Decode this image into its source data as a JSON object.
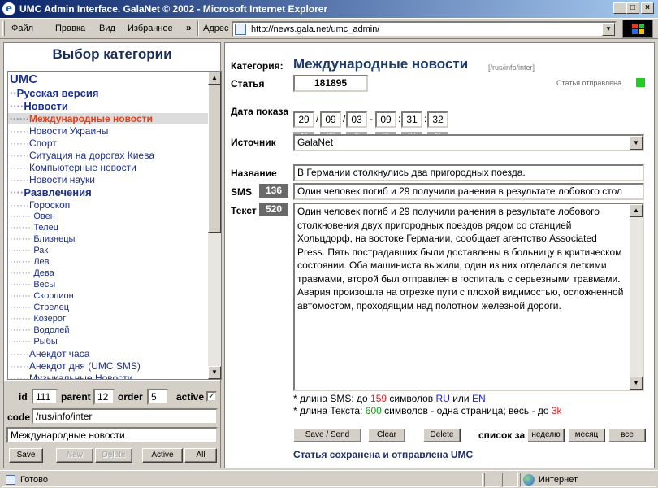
{
  "window": {
    "title": "UMC Admin Interface.   GalaNet © 2002 - Microsoft Internet Explorer",
    "icon": "ie-icon"
  },
  "menu": {
    "items": [
      "Файл",
      "Правка",
      "Вид",
      "Избранное"
    ],
    "more": "»",
    "address_label": "Адрес",
    "url": "http://news.gala.net/umc_admin/"
  },
  "left": {
    "title": "Выбор категории",
    "tree": [
      {
        "dots": "",
        "label": "UMC",
        "style": "root"
      },
      {
        "dots": "··",
        "label": "Русская версия",
        "style": "bold"
      },
      {
        "dots": "····",
        "label": "Новости",
        "style": "bold"
      },
      {
        "dots": "······",
        "label": "Международные новости",
        "style": "sel"
      },
      {
        "dots": "······",
        "label": "Новости Украины",
        "style": ""
      },
      {
        "dots": "······",
        "label": "Спорт",
        "style": ""
      },
      {
        "dots": "······",
        "label": "Ситуация на дорогах Киева",
        "style": ""
      },
      {
        "dots": "······",
        "label": "Компьютерные новости",
        "style": ""
      },
      {
        "dots": "······",
        "label": "Новости науки",
        "style": ""
      },
      {
        "dots": "····",
        "label": "Развлечения",
        "style": "bold"
      },
      {
        "dots": "······",
        "label": "Гороскоп",
        "style": ""
      },
      {
        "dots": "········",
        "label": "Овен",
        "style": "small"
      },
      {
        "dots": "········",
        "label": "Телец",
        "style": "small"
      },
      {
        "dots": "········",
        "label": "Близнецы",
        "style": "small"
      },
      {
        "dots": "········",
        "label": "Рак",
        "style": "small"
      },
      {
        "dots": "········",
        "label": "Лев",
        "style": "small"
      },
      {
        "dots": "········",
        "label": "Дева",
        "style": "small"
      },
      {
        "dots": "········",
        "label": "Весы",
        "style": "small"
      },
      {
        "dots": "········",
        "label": "Скорпион",
        "style": "small"
      },
      {
        "dots": "········",
        "label": "Стрелец",
        "style": "small"
      },
      {
        "dots": "········",
        "label": "Козерог",
        "style": "small"
      },
      {
        "dots": "········",
        "label": "Водолей",
        "style": "small"
      },
      {
        "dots": "········",
        "label": "Рыбы",
        "style": "small"
      },
      {
        "dots": "······",
        "label": "Анекдот часа",
        "style": ""
      },
      {
        "dots": "······",
        "label": "Анекдот дня (UMC SMS)",
        "style": ""
      },
      {
        "dots": "······",
        "label": "Музыкальные Новости",
        "style": ""
      }
    ],
    "form": {
      "id_label": "id",
      "id_value": "111",
      "parent_label": "parent",
      "parent_value": "12",
      "order_label": "order",
      "order_value": "5",
      "active_label": "active",
      "active_checked": "✓",
      "code_label": "code",
      "code_value": "/rus/info/inter",
      "name_value": "Международные новости"
    },
    "buttons": {
      "save": "Save",
      "new": "New",
      "delete": "Delete",
      "active": "Active",
      "all": "All"
    }
  },
  "right": {
    "category_label": "Категория:",
    "category_value": "Международные новости",
    "category_path": "[/rus/info/inter]",
    "article_label": "Статья",
    "article_value": "181895",
    "sent_status": "Статья отправлена",
    "status_color": "#22cc22",
    "date_label": "Дата показа",
    "date": {
      "dd": "29",
      "mm": "09",
      "yy": "03",
      "hh": "09",
      "mi": "31",
      "ss": "32"
    },
    "date_caps": {
      "dd": "дд",
      "mm": "мм",
      "yy": "гг",
      "hh": "чч",
      "mi": "ми",
      "ss": "се"
    },
    "date_sep_slash": "/",
    "date_sep_dash": "-",
    "date_sep_colon": ":",
    "source_label": "Источник",
    "source_value": "GalaNet",
    "title_label": "Название",
    "title_value": "В Германии столкнулись два пригородных поезда.",
    "sms_label": "SMS",
    "sms_count": "136",
    "sms_value": "Один человек погиб и 29 получили ранения в результате лобового стол",
    "text_label": "Текст",
    "text_count": "520",
    "text_value": "Один человек погиб и 29 получили ранения в результате лобового столкновения двух пригородных поездов рядом со станцией Хольцдорф, на востоке Германии, сообщает агентство Associated Press. Пять пострадавших были доставлены в больницу в критическом состоянии. Оба машиниста выжили, один из них отделался легкими травмами, второй был отправлен в госпиталь с серьезными травмами. Авария произошла на отрезке пути с плохой видимостью, осложненной автомостом, проходящим над полотном железной дороги.",
    "note1": {
      "a": "* длина SMS: до ",
      "num": "159",
      "b": " символов ",
      "ru": "RU",
      "c": " или ",
      "en": "EN"
    },
    "note2": {
      "a": "* длина Текста: ",
      "num": "600",
      "b": " символов - одна страница; весь - до ",
      "max": "3k"
    },
    "buttons": {
      "save_send": "Save / Send",
      "clear": "Clear",
      "delete": "Delete"
    },
    "list_label": "список за",
    "list_buttons": {
      "week": "неделю",
      "month": "месяц",
      "all": "все"
    },
    "saved_message": "Статья сохранена и отправлена UMC"
  },
  "status": {
    "ready": "Готово",
    "zone": "Интернет"
  }
}
